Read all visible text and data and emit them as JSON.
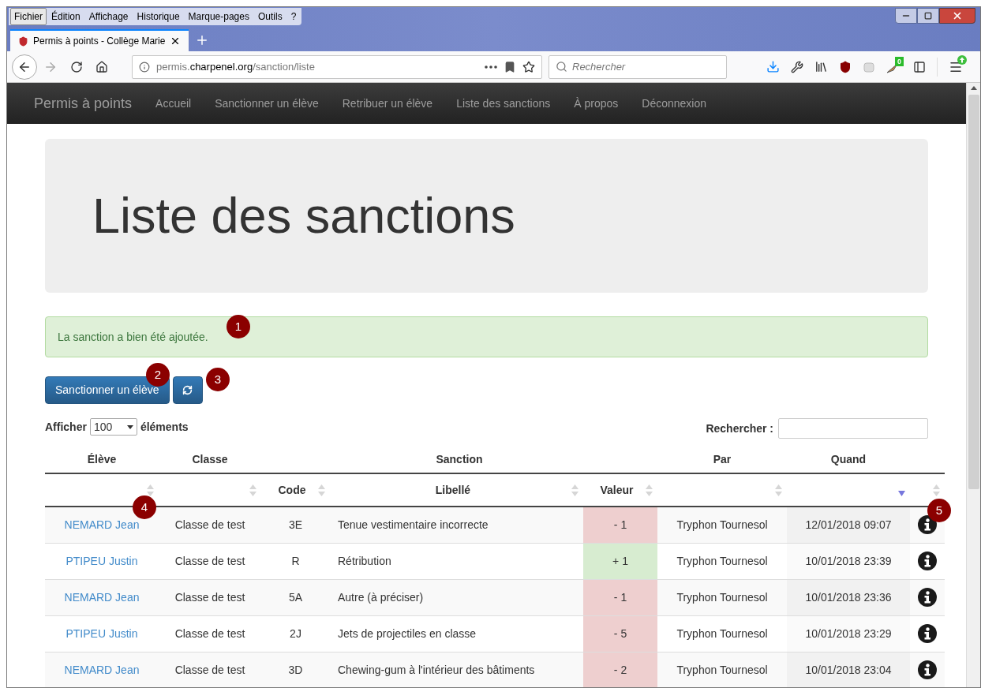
{
  "browser": {
    "menu": [
      {
        "label": "Fichier",
        "selected": true
      },
      {
        "label": "Édition",
        "selected": false
      },
      {
        "label": "Affichage",
        "selected": false
      },
      {
        "label": "Historique",
        "selected": false
      },
      {
        "label": "Marque-pages",
        "selected": false
      },
      {
        "label": "Outils",
        "selected": false
      },
      {
        "label": "?",
        "selected": false
      }
    ],
    "tab": {
      "title": "Permis à points - Collège Marie",
      "selected": true
    },
    "url": {
      "prefix": "permis.",
      "domain": "charpenel.org",
      "path": "/sanction/liste"
    },
    "search": {
      "placeholder": "Rechercher"
    },
    "badge": "0"
  },
  "navbar": {
    "brand": "Permis à points",
    "items": [
      "Accueil",
      "Sanctionner un élève",
      "Retribuer un élève",
      "Liste des sanctions",
      "À propos",
      "Déconnexion"
    ]
  },
  "jumbotron": {
    "title": "Liste des sanctions"
  },
  "alert": "La sanction a bien été ajoutée.",
  "actions": {
    "primary": "Sanctionner un élève"
  },
  "length": {
    "before": "Afficher",
    "value": "100",
    "after": "éléments"
  },
  "filter": {
    "label": "Rechercher :"
  },
  "table": {
    "groups": [
      "Élève",
      "Classe",
      "Sanction",
      "Par",
      "Quand"
    ],
    "columns": [
      {
        "sorted": false
      },
      {
        "sorted": false
      },
      {
        "label": "Code",
        "sorted": false
      },
      {
        "label": "Libellé",
        "sorted": false
      },
      {
        "label": "Valeur",
        "sorted": false
      },
      {
        "sorted": false
      },
      {
        "sorted": true
      },
      {
        "sorted": false
      }
    ],
    "rows": [
      {
        "student": "NEMARD Jean",
        "class": "Classe de test",
        "code": "3E",
        "label": "Tenue vestimentaire incorrecte",
        "value": "- 1",
        "kind": "negative",
        "by": "Tryphon Tournesol",
        "when": "12/01/2018 09:07"
      },
      {
        "student": "PTIPEU Justin",
        "class": "Classe de test",
        "code": "R",
        "label": "Rétribution",
        "value": "+ 1",
        "kind": "positive",
        "by": "Tryphon Tournesol",
        "when": "10/01/2018 23:39"
      },
      {
        "student": "NEMARD Jean",
        "class": "Classe de test",
        "code": "5A",
        "label": "Autre (à préciser)",
        "value": "- 1",
        "kind": "negative",
        "by": "Tryphon Tournesol",
        "when": "10/01/2018 23:36"
      },
      {
        "student": "PTIPEU Justin",
        "class": "Classe de test",
        "code": "2J",
        "label": "Jets de projectiles en classe",
        "value": "- 5",
        "kind": "negative",
        "by": "Tryphon Tournesol",
        "when": "10/01/2018 23:29"
      },
      {
        "student": "NEMARD Jean",
        "class": "Classe de test",
        "code": "3D",
        "label": "Chewing-gum à l'intérieur des bâtiments",
        "value": "- 2",
        "kind": "negative",
        "by": "Tryphon Tournesol",
        "when": "10/01/2018 23:04"
      }
    ]
  },
  "annotations": [
    "1",
    "2",
    "3",
    "4",
    "5"
  ]
}
